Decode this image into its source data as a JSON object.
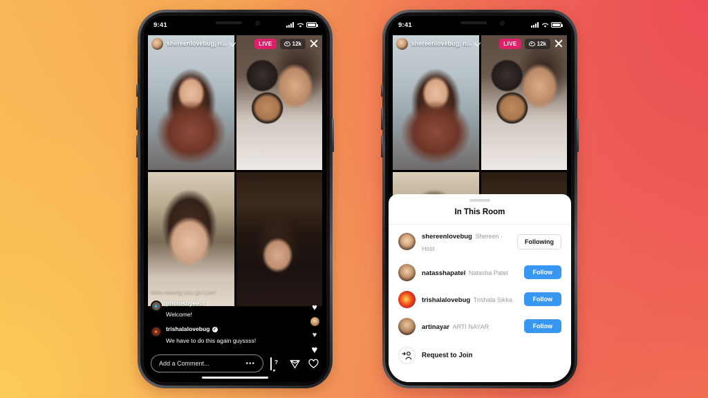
{
  "background": {
    "top_left": "#F5AF53",
    "top_right": "#EA5057",
    "bottom_left": "#FCCB57",
    "bottom_right": "#F07552"
  },
  "accents": {
    "live_badge": "#DE1F6A",
    "follow_blue": "#3897F0",
    "sheet_bg": "#FFFFFF",
    "screen_bg": "#000000"
  },
  "phones": [
    {
      "id": "phone-live-grid",
      "status_bar": {
        "time": "9:41",
        "signal_icon": "cellular-bars-icon",
        "wifi_icon": "wifi-icon",
        "battery_icon": "battery-icon"
      },
      "live_header": {
        "avatar_icon": "host-avatar",
        "title": "shereenlovebug, n...",
        "chevron_icon": "chevron-down-icon",
        "live_label": "LIVE",
        "viewers_icon": "eye-icon",
        "viewers_count": "12k",
        "close_icon": "close-icon"
      },
      "comments": {
        "ghost": "Miss seeing you go Live!",
        "items": [
          {
            "user": "photosbyeeut",
            "verified": false,
            "text": "Welcome!",
            "avatar_icon": "commenter-avatar"
          },
          {
            "user": "trishalalovebug",
            "verified": true,
            "verified_glyph": "✓",
            "text": "We have to do this again guyssss!",
            "avatar_icon": "commenter-avatar"
          }
        ]
      },
      "reactions": {
        "heart_glyph": "♥",
        "avatar_icon": "reaction-avatar"
      },
      "bottom_bar": {
        "comment_placeholder": "Add a Comment...",
        "more_glyph": "•••",
        "question_icon": "question-bubble-icon",
        "question_glyph": "?",
        "share_icon": "paper-plane-icon",
        "like_icon": "heart-outline-icon"
      }
    },
    {
      "id": "phone-in-this-room",
      "status_bar": {
        "time": "9:41",
        "signal_icon": "cellular-bars-icon",
        "wifi_icon": "wifi-icon",
        "battery_icon": "battery-icon"
      },
      "live_header": {
        "avatar_icon": "host-avatar",
        "title": "shereenlovebug, n...",
        "chevron_icon": "chevron-down-icon",
        "live_label": "LIVE",
        "viewers_icon": "eye-icon",
        "viewers_count": "12k",
        "close_icon": "close-icon"
      },
      "sheet": {
        "title": "In This Room",
        "participants": [
          {
            "username": "shereenlovebug",
            "name": "Shereen · Host",
            "action": "Following",
            "action_style": "outline",
            "avatar_icon": "participant-avatar"
          },
          {
            "username": "natasshapatel",
            "name": "Natasha Patel",
            "action": "Follow",
            "action_style": "filled",
            "avatar_icon": "participant-avatar"
          },
          {
            "username": "trishalalovebug",
            "name": "Trishala Sikka",
            "action": "Follow",
            "action_style": "filled",
            "avatar_icon": "participant-avatar"
          },
          {
            "username": "artinayar",
            "name": "ARTI NAYAR",
            "action": "Follow",
            "action_style": "filled",
            "avatar_icon": "participant-avatar"
          }
        ],
        "request_to_join": {
          "label": "Request to Join",
          "icon": "add-person-icon"
        }
      }
    }
  ]
}
